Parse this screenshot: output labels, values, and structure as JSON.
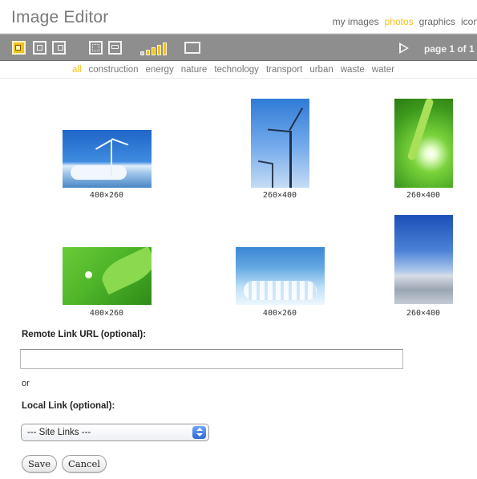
{
  "app": {
    "title": "Image Editor"
  },
  "nav": {
    "items": [
      {
        "label": "my images",
        "active": false
      },
      {
        "label": "photos",
        "active": true
      },
      {
        "label": "graphics",
        "active": false
      },
      {
        "label": "icons",
        "active": false
      }
    ]
  },
  "toolbar": {
    "buttons": [
      {
        "icon": "align-left-icon",
        "active": true
      },
      {
        "icon": "align-center-icon",
        "active": false
      },
      {
        "icon": "align-right-icon",
        "active": false
      },
      {
        "icon": "layout-grid-icon",
        "active": false
      },
      {
        "icon": "layout-list-icon",
        "active": false
      }
    ],
    "size_icons": [
      "size-1-icon",
      "size-2-icon",
      "size-3-icon",
      "size-4-icon",
      "size-5-icon",
      "size-screen-icon"
    ],
    "play_icon": "play-icon",
    "page_label": "page 1 of 1"
  },
  "categories": {
    "items": [
      "all",
      "construction",
      "energy",
      "nature",
      "technology",
      "transport",
      "urban",
      "waste",
      "water"
    ],
    "active": "all"
  },
  "gallery": {
    "images": [
      {
        "name": "wind-turbine-sky",
        "size": "400×260"
      },
      {
        "name": "wind-turbines-tall",
        "size": "260×400"
      },
      {
        "name": "green-leaf-drop",
        "size": "260×400"
      },
      {
        "name": "green-leaf-closeup",
        "size": "400×260"
      },
      {
        "name": "water-wake",
        "size": "400×260"
      },
      {
        "name": "sky-over-sea",
        "size": "260×400"
      }
    ]
  },
  "form": {
    "remote_label": "Remote Link URL (optional):",
    "remote_value": "",
    "or_text": "or",
    "local_label": "Local Link (optional):",
    "local_selected": "--- Site Links ---",
    "save_label": "Save",
    "cancel_label": "Cancel"
  },
  "colors": {
    "accent": "#f3c21a",
    "toolbar": "#8e8e8e"
  }
}
